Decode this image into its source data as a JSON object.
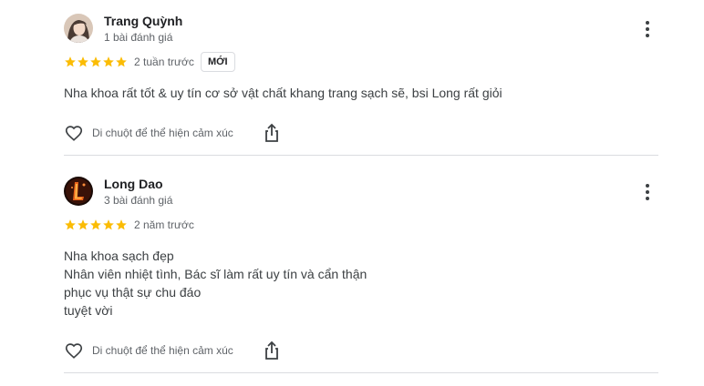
{
  "reviews": [
    {
      "name": "Trang Quỳnh",
      "meta": "1 bài đánh giá",
      "rating": 5,
      "time": "2 tuần trước",
      "badge": "MỚI",
      "text_lines": [
        "Nha khoa rất tốt & uy tín cơ sở vật chất khang trang sạch sẽ, bsi Long rất giỏi"
      ],
      "like_label": "Di chuột để thể hiện cảm xúc"
    },
    {
      "name": "Long Dao",
      "meta": "3 bài đánh giá",
      "rating": 5,
      "time": "2 năm trước",
      "text_lines": [
        "Nha khoa sạch đẹp",
        "Nhân viên nhiệt tình, Bác sĩ làm rất uy tín và cẩn thận",
        "phục vụ thật sự chu đáo",
        "tuyệt vời"
      ],
      "like_label": "Di chuột để thể hiện cảm xúc"
    }
  ],
  "icons": {
    "star": "star-icon",
    "more": "more-vert-icon",
    "like": "heart-icon",
    "share": "share-icon"
  },
  "colors": {
    "star": "#fbbc04",
    "text": "#202124",
    "secondary": "#5f6368",
    "divider": "#dadce0"
  }
}
